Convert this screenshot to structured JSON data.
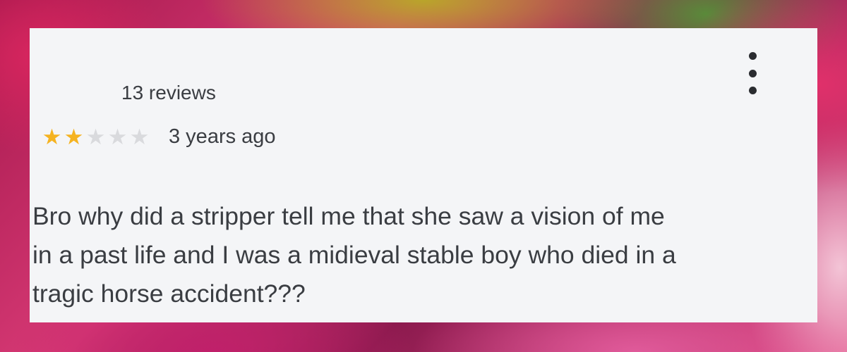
{
  "review": {
    "reviews_count": "13 reviews",
    "rating": 2,
    "rating_max": 5,
    "time_ago": "3 years ago",
    "text": "Bro why did a stripper tell me that she saw a vision of me\nin a past life and I was a midieval stable boy who died in a\ntragic horse accident???"
  },
  "icons": {
    "menu": "more-vertical-icon",
    "star_filled": "star-filled-icon",
    "star_empty": "star-empty-icon"
  },
  "colors": {
    "star_filled": "#f5b321",
    "star_empty": "#d9dadd",
    "card_background": "#f4f5f7",
    "text": "#3a3d42"
  }
}
